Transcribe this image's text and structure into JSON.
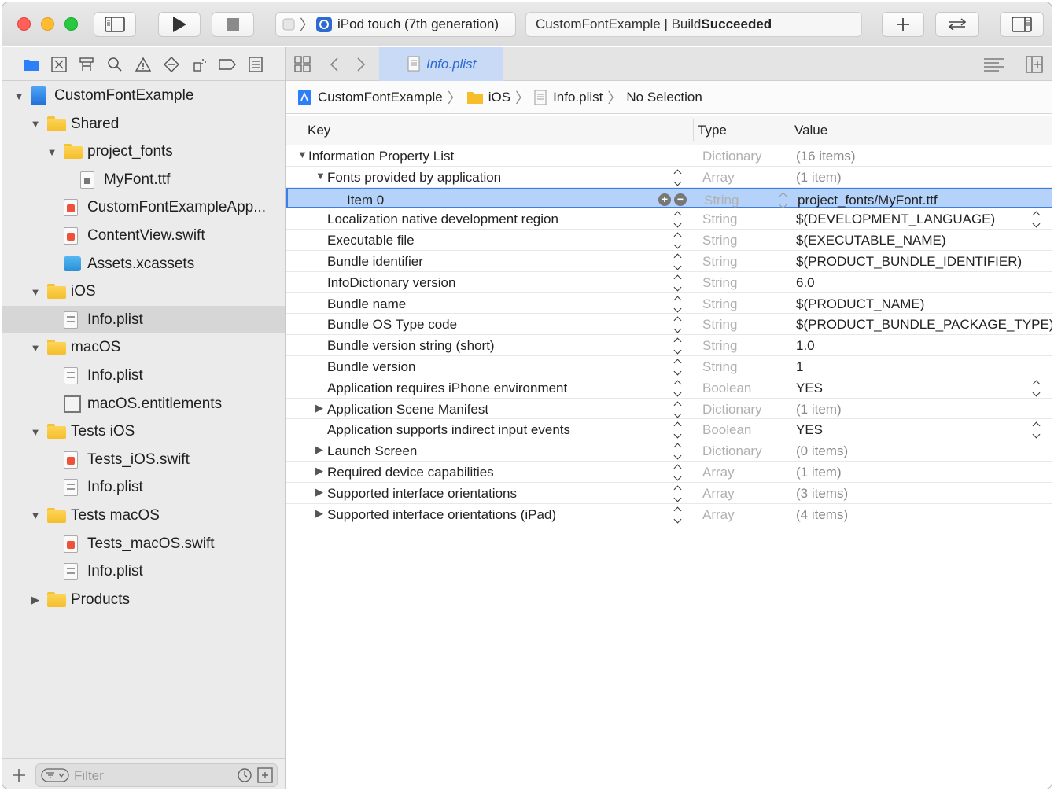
{
  "toolbar": {
    "scheme_device": "iPod touch (7th generation)",
    "activity_project": "CustomFontExample | Build ",
    "activity_status": "Succeeded"
  },
  "navigator": {
    "filter_placeholder": "Filter",
    "items": [
      {
        "label": "CustomFontExample",
        "depth": 0,
        "kind": "project",
        "disclosure": "open"
      },
      {
        "label": "Shared",
        "depth": 1,
        "kind": "folder",
        "disclosure": "open"
      },
      {
        "label": "project_fonts",
        "depth": 2,
        "kind": "folder",
        "disclosure": "open"
      },
      {
        "label": "MyFont.ttf",
        "depth": 3,
        "kind": "ttf",
        "disclosure": "none"
      },
      {
        "label": "CustomFontExampleApp...",
        "depth": 2,
        "kind": "swift",
        "disclosure": "none"
      },
      {
        "label": "ContentView.swift",
        "depth": 2,
        "kind": "swift",
        "disclosure": "none"
      },
      {
        "label": "Assets.xcassets",
        "depth": 2,
        "kind": "xcassets",
        "disclosure": "none"
      },
      {
        "label": "iOS",
        "depth": 1,
        "kind": "folder",
        "disclosure": "open"
      },
      {
        "label": "Info.plist",
        "depth": 2,
        "kind": "plist",
        "disclosure": "none",
        "selected": true
      },
      {
        "label": "macOS",
        "depth": 1,
        "kind": "folder",
        "disclosure": "open"
      },
      {
        "label": "Info.plist",
        "depth": 2,
        "kind": "plist",
        "disclosure": "none"
      },
      {
        "label": "macOS.entitlements",
        "depth": 2,
        "kind": "entitlements",
        "disclosure": "none"
      },
      {
        "label": "Tests iOS",
        "depth": 1,
        "kind": "folder",
        "disclosure": "open"
      },
      {
        "label": "Tests_iOS.swift",
        "depth": 2,
        "kind": "swift",
        "disclosure": "none"
      },
      {
        "label": "Info.plist",
        "depth": 2,
        "kind": "plist",
        "disclosure": "none"
      },
      {
        "label": "Tests macOS",
        "depth": 1,
        "kind": "folder",
        "disclosure": "open"
      },
      {
        "label": "Tests_macOS.swift",
        "depth": 2,
        "kind": "swift",
        "disclosure": "none"
      },
      {
        "label": "Info.plist",
        "depth": 2,
        "kind": "plist",
        "disclosure": "none"
      },
      {
        "label": "Products",
        "depth": 1,
        "kind": "folder",
        "disclosure": "closed"
      }
    ]
  },
  "editor": {
    "tab_label": "Info.plist",
    "jumpbar": [
      "CustomFontExample",
      "iOS",
      "Info.plist",
      "No Selection"
    ],
    "columns": {
      "key": "Key",
      "type": "Type",
      "value": "Value"
    },
    "rows": [
      {
        "key": "Information Property List",
        "type": "Dictionary",
        "value": "(16 items)",
        "level": 0,
        "disclosure": "open",
        "stepper": false,
        "value_dim": true
      },
      {
        "key": "Fonts provided by application",
        "type": "Array",
        "value": "(1 item)",
        "level": 1,
        "disclosure": "open",
        "stepper": true,
        "value_dim": true
      },
      {
        "key": "Item 0",
        "type": "String",
        "value": "project_fonts/MyFont.ttf",
        "level": 2,
        "disclosure": "none",
        "stepper": false,
        "selected": true
      },
      {
        "key": "Localization native development region",
        "type": "String",
        "value": "$(DEVELOPMENT_LANGUAGE)",
        "level": 1,
        "disclosure": "none",
        "stepper": true,
        "value_stepper": true
      },
      {
        "key": "Executable file",
        "type": "String",
        "value": "$(EXECUTABLE_NAME)",
        "level": 1,
        "disclosure": "none",
        "stepper": true
      },
      {
        "key": "Bundle identifier",
        "type": "String",
        "value": "$(PRODUCT_BUNDLE_IDENTIFIER)",
        "level": 1,
        "disclosure": "none",
        "stepper": true
      },
      {
        "key": "InfoDictionary version",
        "type": "String",
        "value": "6.0",
        "level": 1,
        "disclosure": "none",
        "stepper": true
      },
      {
        "key": "Bundle name",
        "type": "String",
        "value": "$(PRODUCT_NAME)",
        "level": 1,
        "disclosure": "none",
        "stepper": true
      },
      {
        "key": "Bundle OS Type code",
        "type": "String",
        "value": "$(PRODUCT_BUNDLE_PACKAGE_TYPE)",
        "level": 1,
        "disclosure": "none",
        "stepper": true
      },
      {
        "key": "Bundle version string (short)",
        "type": "String",
        "value": "1.0",
        "level": 1,
        "disclosure": "none",
        "stepper": true
      },
      {
        "key": "Bundle version",
        "type": "String",
        "value": "1",
        "level": 1,
        "disclosure": "none",
        "stepper": true
      },
      {
        "key": "Application requires iPhone environment",
        "type": "Boolean",
        "value": "YES",
        "level": 1,
        "disclosure": "none",
        "stepper": true,
        "value_stepper": true
      },
      {
        "key": "Application Scene Manifest",
        "type": "Dictionary",
        "value": "(1 item)",
        "level": 1,
        "disclosure": "closed",
        "stepper": true,
        "value_dim": true
      },
      {
        "key": "Application supports indirect input events",
        "type": "Boolean",
        "value": "YES",
        "level": 1,
        "disclosure": "none",
        "stepper": true,
        "value_stepper": true
      },
      {
        "key": "Launch Screen",
        "type": "Dictionary",
        "value": "(0 items)",
        "level": 1,
        "disclosure": "closed",
        "stepper": true,
        "value_dim": true
      },
      {
        "key": "Required device capabilities",
        "type": "Array",
        "value": "(1 item)",
        "level": 1,
        "disclosure": "closed",
        "stepper": true,
        "value_dim": true
      },
      {
        "key": "Supported interface orientations",
        "type": "Array",
        "value": "(3 items)",
        "level": 1,
        "disclosure": "closed",
        "stepper": true,
        "value_dim": true
      },
      {
        "key": "Supported interface orientations (iPad)",
        "type": "Array",
        "value": "(4 items)",
        "level": 1,
        "disclosure": "closed",
        "stepper": true,
        "value_dim": true
      }
    ]
  },
  "colors": {
    "accent": "#3d7ee6",
    "selection": "#b5d3fa",
    "folder": "#f5be2a",
    "swift": "#f05138"
  }
}
